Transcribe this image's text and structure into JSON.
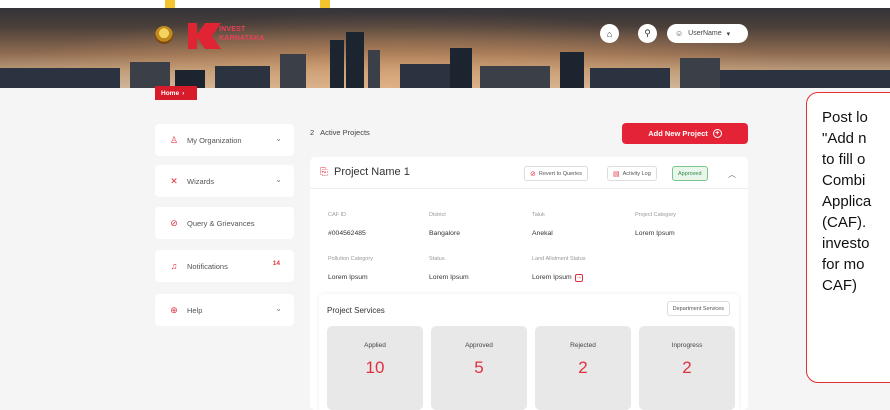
{
  "header": {
    "brand_line1": "INVEST",
    "brand_line2": "KARNATAKA",
    "home_icon": "home-icon",
    "search_icon": "search-icon",
    "user_label": "UserName",
    "user_icon": "user-icon",
    "dropdown_icon": "chevron-down-icon"
  },
  "breadcrumb": {
    "home": "Home",
    "arrow": "›"
  },
  "sidebar": {
    "items": [
      {
        "label": "My Organization",
        "icon": "user-icon",
        "chevron": "⌄"
      },
      {
        "label": "Wizards",
        "icon": "wizard-icon",
        "chevron": "⌄"
      },
      {
        "label": "Query & Grievances",
        "icon": "query-icon"
      },
      {
        "label": "Notifications",
        "icon": "bell-icon",
        "badge": "14"
      },
      {
        "label": "Help",
        "icon": "help-icon",
        "chevron": "⌄"
      }
    ]
  },
  "main": {
    "active_count": "2",
    "active_label": "Active Projects",
    "add_button": "Add New Project",
    "project": {
      "title": "Project Name 1",
      "revert_label": "Revert to Queries",
      "activity_label": "Activity Log",
      "status": "Approved",
      "fields": {
        "caf_id": {
          "label": "CAF ID",
          "value": "#004562485"
        },
        "district": {
          "label": "District",
          "value": "Bangalore"
        },
        "taluk": {
          "label": "Taluk",
          "value": "Anekal"
        },
        "project_category": {
          "label": "Project Category",
          "value": "Lorem Ipsum"
        },
        "pollution_category": {
          "label": "Pollution Category",
          "value": "Lorem Ipsum"
        },
        "status": {
          "label": "Status",
          "value": "Lorem Ipsum"
        },
        "land_allotment": {
          "label": "Land Allotment Status",
          "value": "Lorem Ipsum"
        }
      },
      "services": {
        "title": "Project Services",
        "dept_button": "Department Services",
        "tiles": [
          {
            "label": "Applied",
            "value": "10"
          },
          {
            "label": "Approved",
            "value": "5"
          },
          {
            "label": "Rejected",
            "value": "2"
          },
          {
            "label": "Inprogress",
            "value": "2"
          }
        ]
      }
    }
  },
  "callout": {
    "lines": [
      "Post lo",
      "\"Add n",
      "to fill o",
      "Combi",
      "Applica",
      "(CAF).",
      "investo",
      "for mo",
      "CAF)"
    ]
  },
  "colors": {
    "accent": "#e42436",
    "approved": "#2e8b45"
  }
}
